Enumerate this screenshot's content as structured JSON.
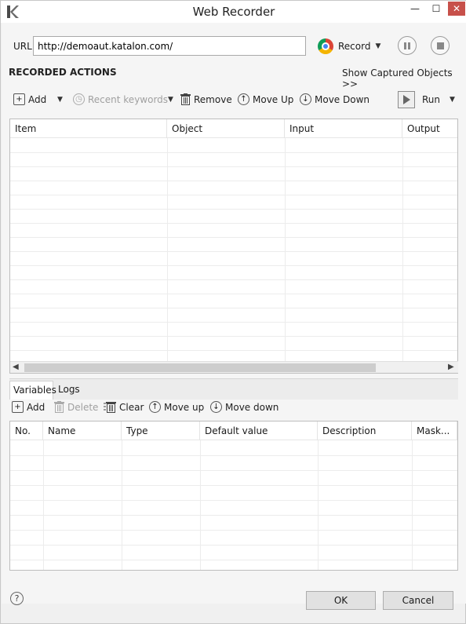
{
  "window": {
    "title": "Web Recorder",
    "controls": {
      "minimize": "—",
      "maximize": "☐",
      "close": "✕"
    }
  },
  "url_bar": {
    "label": "URL",
    "value": "http://demoaut.katalon.com/",
    "record_label": "Record"
  },
  "recorded_actions": {
    "title": "RECORDED ACTIONS",
    "show_captured": "Show Captured Objects >>",
    "toolbar": {
      "add": "Add",
      "recent_keywords": "Recent keywords",
      "remove": "Remove",
      "move_up": "Move Up",
      "move_down": "Move Down",
      "run": "Run"
    },
    "columns": [
      "Item",
      "Object",
      "Input",
      "Output"
    ]
  },
  "bottom_panel": {
    "tabs": [
      "Variables",
      "Logs"
    ],
    "toolbar": {
      "add": "Add",
      "delete": "Delete",
      "clear": "Clear",
      "move_up": "Move up",
      "move_down": "Move down"
    },
    "columns": [
      "No.",
      "Name",
      "Type",
      "Default value",
      "Description",
      "Mask..."
    ]
  },
  "dialog": {
    "help": "?",
    "ok": "OK",
    "cancel": "Cancel"
  },
  "colors": {
    "close_button": "#c7504a",
    "background": "#f5f5f5"
  }
}
